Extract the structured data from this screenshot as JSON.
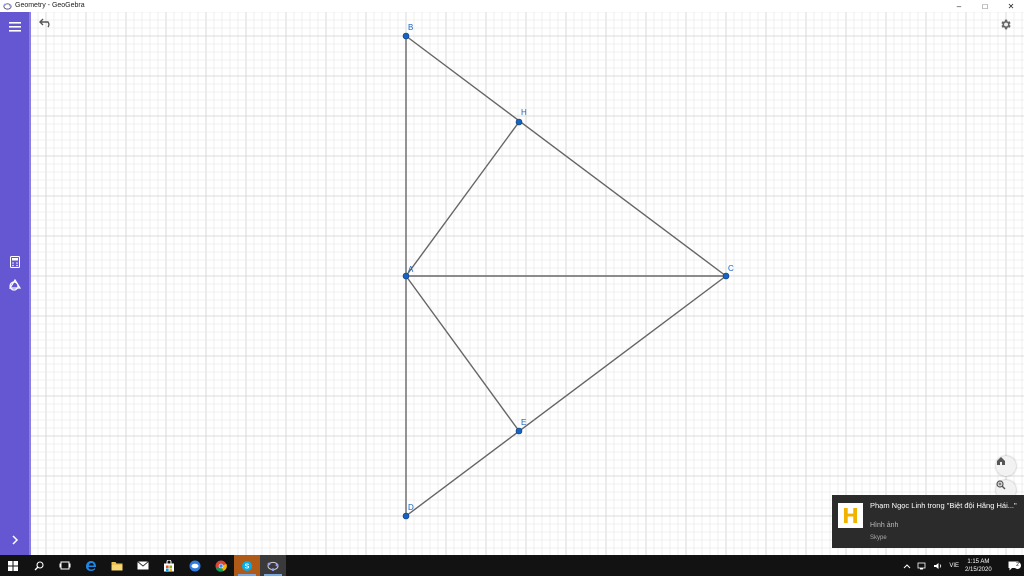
{
  "window": {
    "title": "Geometry - GeoGebra",
    "controls": {
      "minimize": "–",
      "maximize": "□",
      "close": "✕"
    }
  },
  "sidebar": {
    "items": [
      {
        "icon": "hamburger-menu-icon"
      },
      {
        "icon": "calculator-icon"
      },
      {
        "icon": "shapes-icon"
      },
      {
        "icon": "chevron-right-icon"
      }
    ],
    "color": "#6557d2"
  },
  "canvas": {
    "toolbar": {
      "undo_icon": "undo-icon",
      "settings_icon": "gear-icon"
    },
    "zoom_controls": [
      "home-icon",
      "zoom-in-icon"
    ],
    "points": [
      {
        "name": "B"
      },
      {
        "name": "H"
      },
      {
        "name": "A"
      },
      {
        "name": "C"
      },
      {
        "name": "E"
      },
      {
        "name": "D"
      }
    ],
    "colors": {
      "point": "#1565c0",
      "segment": "#666666",
      "label": "#1565c0",
      "grid_minor": "#ebebeb",
      "grid_major": "#d0d0d0"
    }
  },
  "notification": {
    "logo_letter": "H",
    "title": "Phạm Ngọc Linh trong \"Biệt đội Hăng Hái...\"",
    "subtitle": "Hình ảnh",
    "app": "Skype"
  },
  "taskbar": {
    "icons": [
      "windows-start-icon",
      "search-icon",
      "task-view-icon",
      "edge-icon",
      "file-explorer-icon",
      "mail-icon",
      "store-icon",
      "zalo-icon",
      "chrome-icon",
      "skype-icon",
      "geogebra-icon"
    ],
    "language": "VIE",
    "time": "1:15 AM",
    "date": "2/15/2020",
    "notification_count": "2"
  }
}
